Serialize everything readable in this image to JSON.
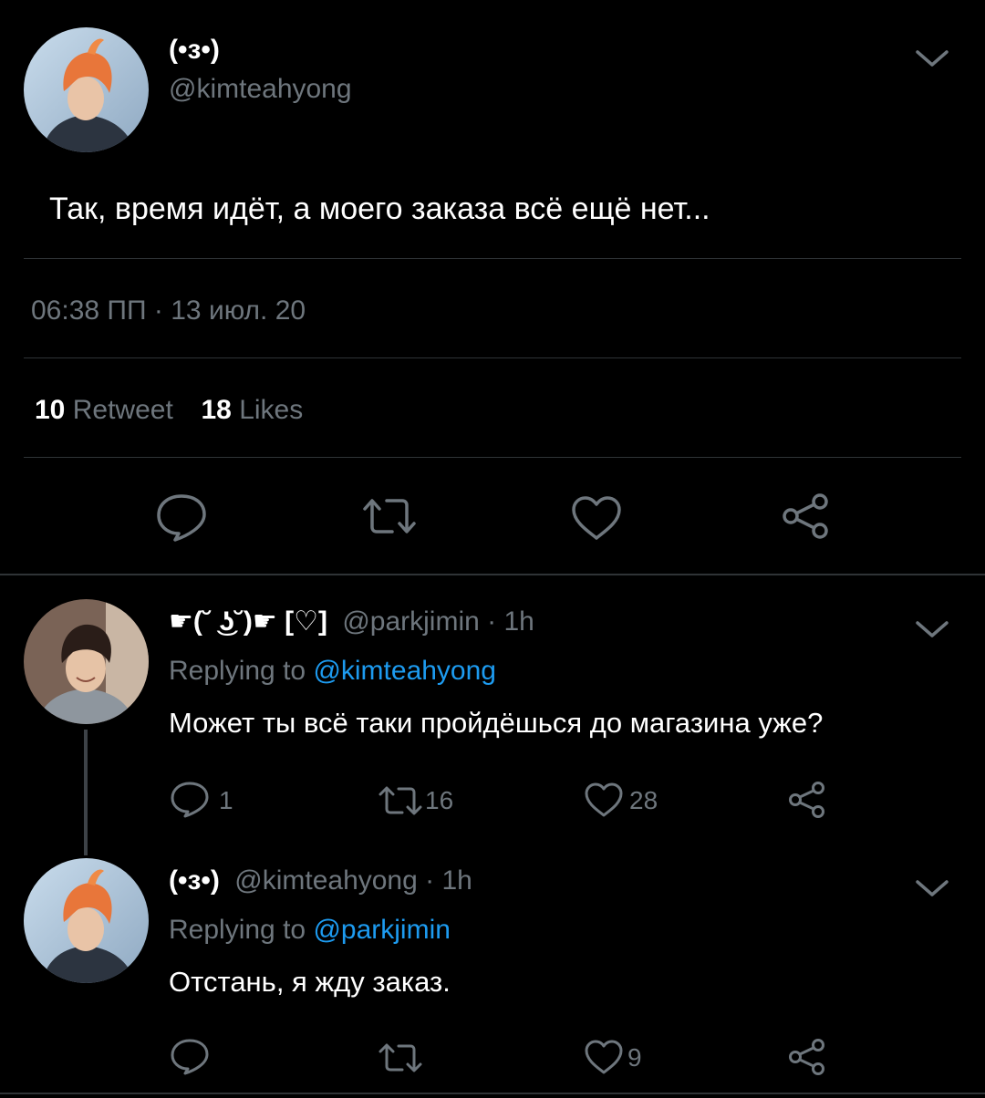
{
  "main_tweet": {
    "display_name": "(•з•)",
    "handle": "@kimteahyong",
    "text": "Так, время идёт, а моего заказа всё ещё нет...",
    "time": "06:38 ПП",
    "separator": "·",
    "date": "13 июл. 20",
    "retweets_count": "10",
    "retweets_label": "Retweet",
    "likes_count": "18",
    "likes_label": "Likes",
    "actions": [
      "reply-icon",
      "retweet-icon",
      "like-icon",
      "share-icon"
    ]
  },
  "replies": [
    {
      "display_name": "☛(˘ ͜ʖ˘)☛ [♡]",
      "handle": "@parkjimin",
      "time": "· 1h",
      "replying_prefix": "Replying to",
      "replying_to": "@kimteahyong",
      "text": "Может ты всё таки пройдёшься до магазина уже?",
      "reply_count": "1",
      "retweet_count": "16",
      "like_count": "28"
    },
    {
      "display_name": "(•з•)",
      "handle": "@kimteahyong",
      "time": "· 1h",
      "replying_prefix": "Replying to",
      "replying_to": "@parkjimin",
      "text": "Отстань, я жду заказ.",
      "like_count": "9"
    }
  ],
  "colors": {
    "background": "#000000",
    "text": "#e7e9ea",
    "muted": "#6e767d",
    "link": "#1d9bf0",
    "divider": "#2f3336"
  }
}
